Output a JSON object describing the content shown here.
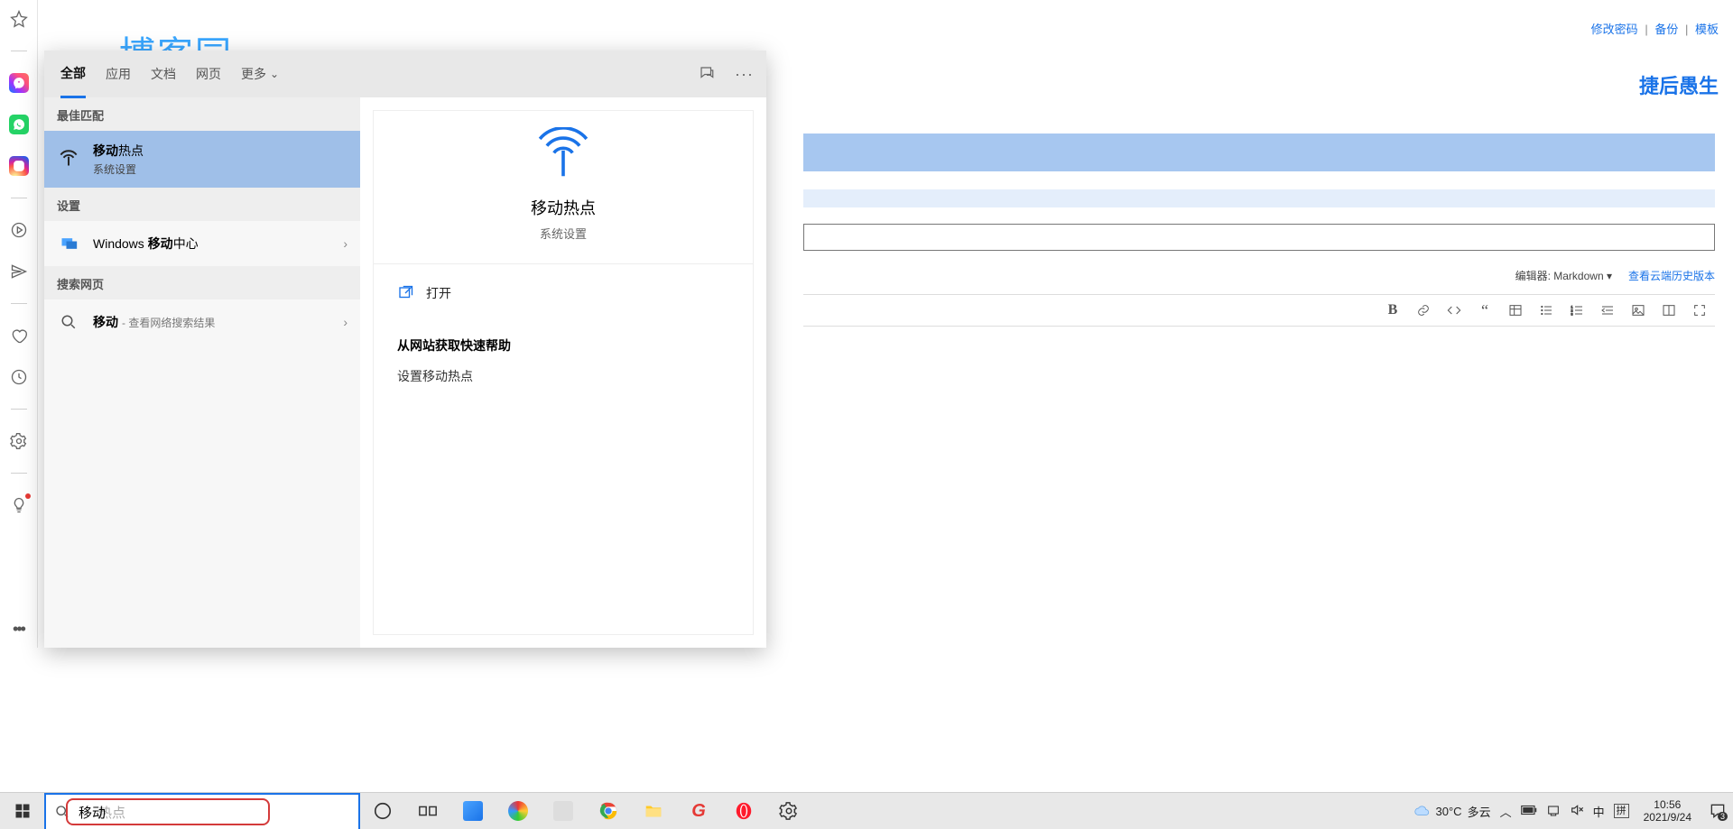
{
  "leftbar": {
    "icons": [
      "star",
      "messenger",
      "whatsapp",
      "instagram",
      "play-circle",
      "send",
      "heart",
      "clock",
      "gear",
      "lightbulb"
    ]
  },
  "bg": {
    "logo_partial": "博客园",
    "top_links": {
      "change_pwd": "修改密码",
      "backup": "备份",
      "template": "模板",
      "sep": "|"
    },
    "brand": "捷后愚生",
    "editor_label": "编辑器: Markdown",
    "history_link": "查看云端历史版本"
  },
  "search_panel": {
    "tabs": {
      "all": "全部",
      "apps": "应用",
      "docs": "文档",
      "web": "网页",
      "more": "更多"
    },
    "left": {
      "best_match": "最佳匹配",
      "result_title_bold": "移动",
      "result_title_rest": "热点",
      "result_sub": "系统设置",
      "settings": "设置",
      "settings_item": "Windows 移动中心",
      "settings_item_bold": "移动",
      "settings_item_prefix": "Windows ",
      "settings_item_suffix": "中心",
      "search_web": "搜索网页",
      "web_item_bold": "移动",
      "web_item_hint": "- 查看网络搜索结果"
    },
    "right": {
      "title": "移动热点",
      "sub": "系统设置",
      "open": "打开",
      "help_title": "从网站获取快速帮助",
      "help_link": "设置移动热点"
    }
  },
  "taskbar": {
    "search_value": "移动",
    "search_placeholder": "热点",
    "weather": {
      "temp": "30°C",
      "desc": "多云"
    },
    "ime_lang": "中",
    "ime_method": "拼",
    "time": "10:56",
    "date": "2021/9/24",
    "notif_count": "3"
  }
}
